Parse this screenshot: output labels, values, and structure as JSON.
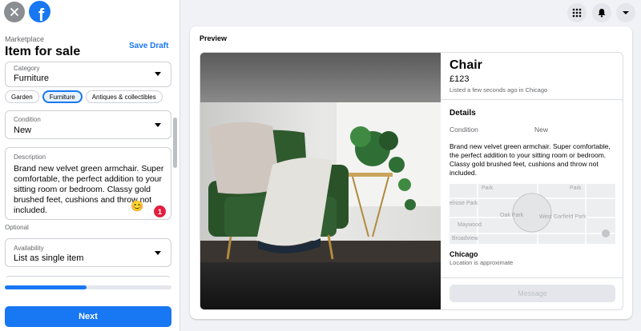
{
  "header": {
    "breadcrumb": "Marketplace",
    "title": "Item for sale",
    "save_draft": "Save Draft",
    "logo_letter": "f"
  },
  "form": {
    "category": {
      "label": "Category",
      "value": "Furniture"
    },
    "chips": [
      "Garden",
      "Furniture",
      "Antiques & collectibles"
    ],
    "selected_chip": "Furniture",
    "condition": {
      "label": "Condition",
      "value": "New"
    },
    "description": {
      "label": "Description",
      "value": "Brand new velvet green armchair. Super comfortable, the perfect addition to your sitting room or bedroom. Classy gold brushed feet, cushions and throw not included."
    },
    "notification_count": "1",
    "optional_label": "Optional",
    "availability": {
      "label": "Availability",
      "value": "List as single item"
    },
    "progress_fraction": 0.49,
    "next_label": "Next"
  },
  "preview": {
    "label": "Preview",
    "title": "Chair",
    "price": "£123",
    "listed": "Listed a few seconds ago in Chicago",
    "details_heading": "Details",
    "condition_label": "Condition",
    "condition_value": "New",
    "description": "Brand new velvet green armchair. Super comfortable, the perfect addition to your sitting room or bedroom. Classy gold brushed feet, cushions and throw not included.",
    "map_labels": [
      "Park",
      "Park",
      "Oak Park",
      "West Garfield Park",
      "Maywood",
      "elrose Park",
      "Broadview"
    ],
    "location_name": "Chicago",
    "location_note": "Location is approximate",
    "message_label": "Message"
  },
  "icons": {
    "close": "close-icon",
    "menu": "grid-menu-icon",
    "notifications": "bell-icon",
    "account": "chevron-down-icon"
  },
  "colors": {
    "accent": "#1877f2",
    "chair_green": "#2f5a2e"
  }
}
